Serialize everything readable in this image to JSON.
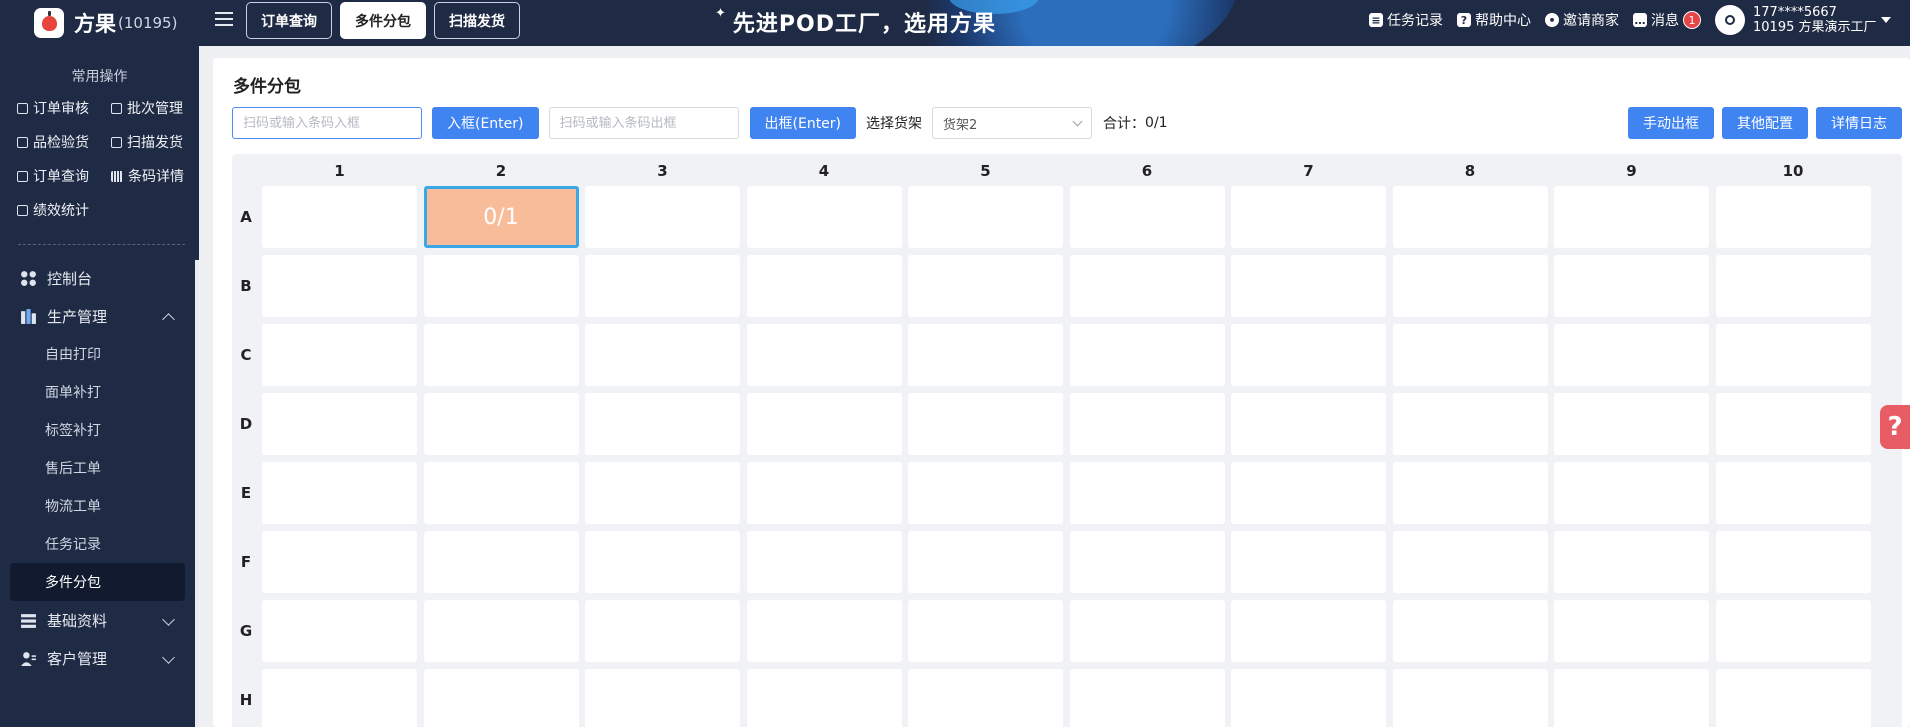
{
  "app": {
    "name": "方果",
    "id": "(10195)"
  },
  "sidebar": {
    "section_title": "常用操作",
    "quick": [
      {
        "label": "订单审核",
        "icon": "checkbox-icon"
      },
      {
        "label": "批次管理",
        "icon": "batch-icon"
      },
      {
        "label": "品检验货",
        "icon": "inspect-icon"
      },
      {
        "label": "扫描发货",
        "icon": "scan-icon"
      },
      {
        "label": "订单查询",
        "icon": "search-doc-icon"
      },
      {
        "label": "条码详情",
        "icon": "barcode-icon"
      },
      {
        "label": "绩效统计",
        "icon": "chart-icon"
      }
    ],
    "nav": [
      {
        "label": "控制台",
        "icon": "dashboard-icon"
      },
      {
        "label": "生产管理",
        "icon": "production-icon",
        "expanded": true
      },
      {
        "label": "基础资料",
        "icon": "database-icon"
      },
      {
        "label": "客户管理",
        "icon": "customer-icon"
      }
    ],
    "sub": [
      "自由打印",
      "面单补打",
      "标签补打",
      "售后工单",
      "物流工单",
      "任务记录",
      "多件分包"
    ],
    "active_sub": "多件分包"
  },
  "topbar": {
    "tabs": [
      "订单查询",
      "多件分包",
      "扫描发货"
    ],
    "active_tab": "多件分包",
    "slogan": "先进POD工厂，选用方果",
    "links": [
      "任务记录",
      "帮助中心",
      "邀请商家",
      "消息"
    ],
    "message_count": "1",
    "user_phone": "177****5667",
    "user_org": "10195 方果演示工厂"
  },
  "page": {
    "title": "多件分包",
    "in_placeholder": "扫码或输入条码入框",
    "in_button": "入框(Enter)",
    "out_placeholder": "扫码或输入条码出框",
    "out_button": "出框(Enter)",
    "shelf_label": "选择货架",
    "shelf_value": "货架2",
    "total_label": "合计：",
    "total_value": "0/1",
    "buttons": [
      "手动出框",
      "其他配置",
      "详情日志"
    ]
  },
  "grid": {
    "columns": [
      "1",
      "2",
      "3",
      "4",
      "5",
      "6",
      "7",
      "8",
      "9",
      "10"
    ],
    "rows": [
      "A",
      "B",
      "C",
      "D",
      "E",
      "F",
      "G",
      "H"
    ],
    "filled": [
      {
        "row": "A",
        "col": "2",
        "value": "0/1"
      }
    ],
    "colors": {
      "filled_bg": "#f9bc9b",
      "filled_border": "#3aa7e8"
    }
  },
  "help_button": "?"
}
